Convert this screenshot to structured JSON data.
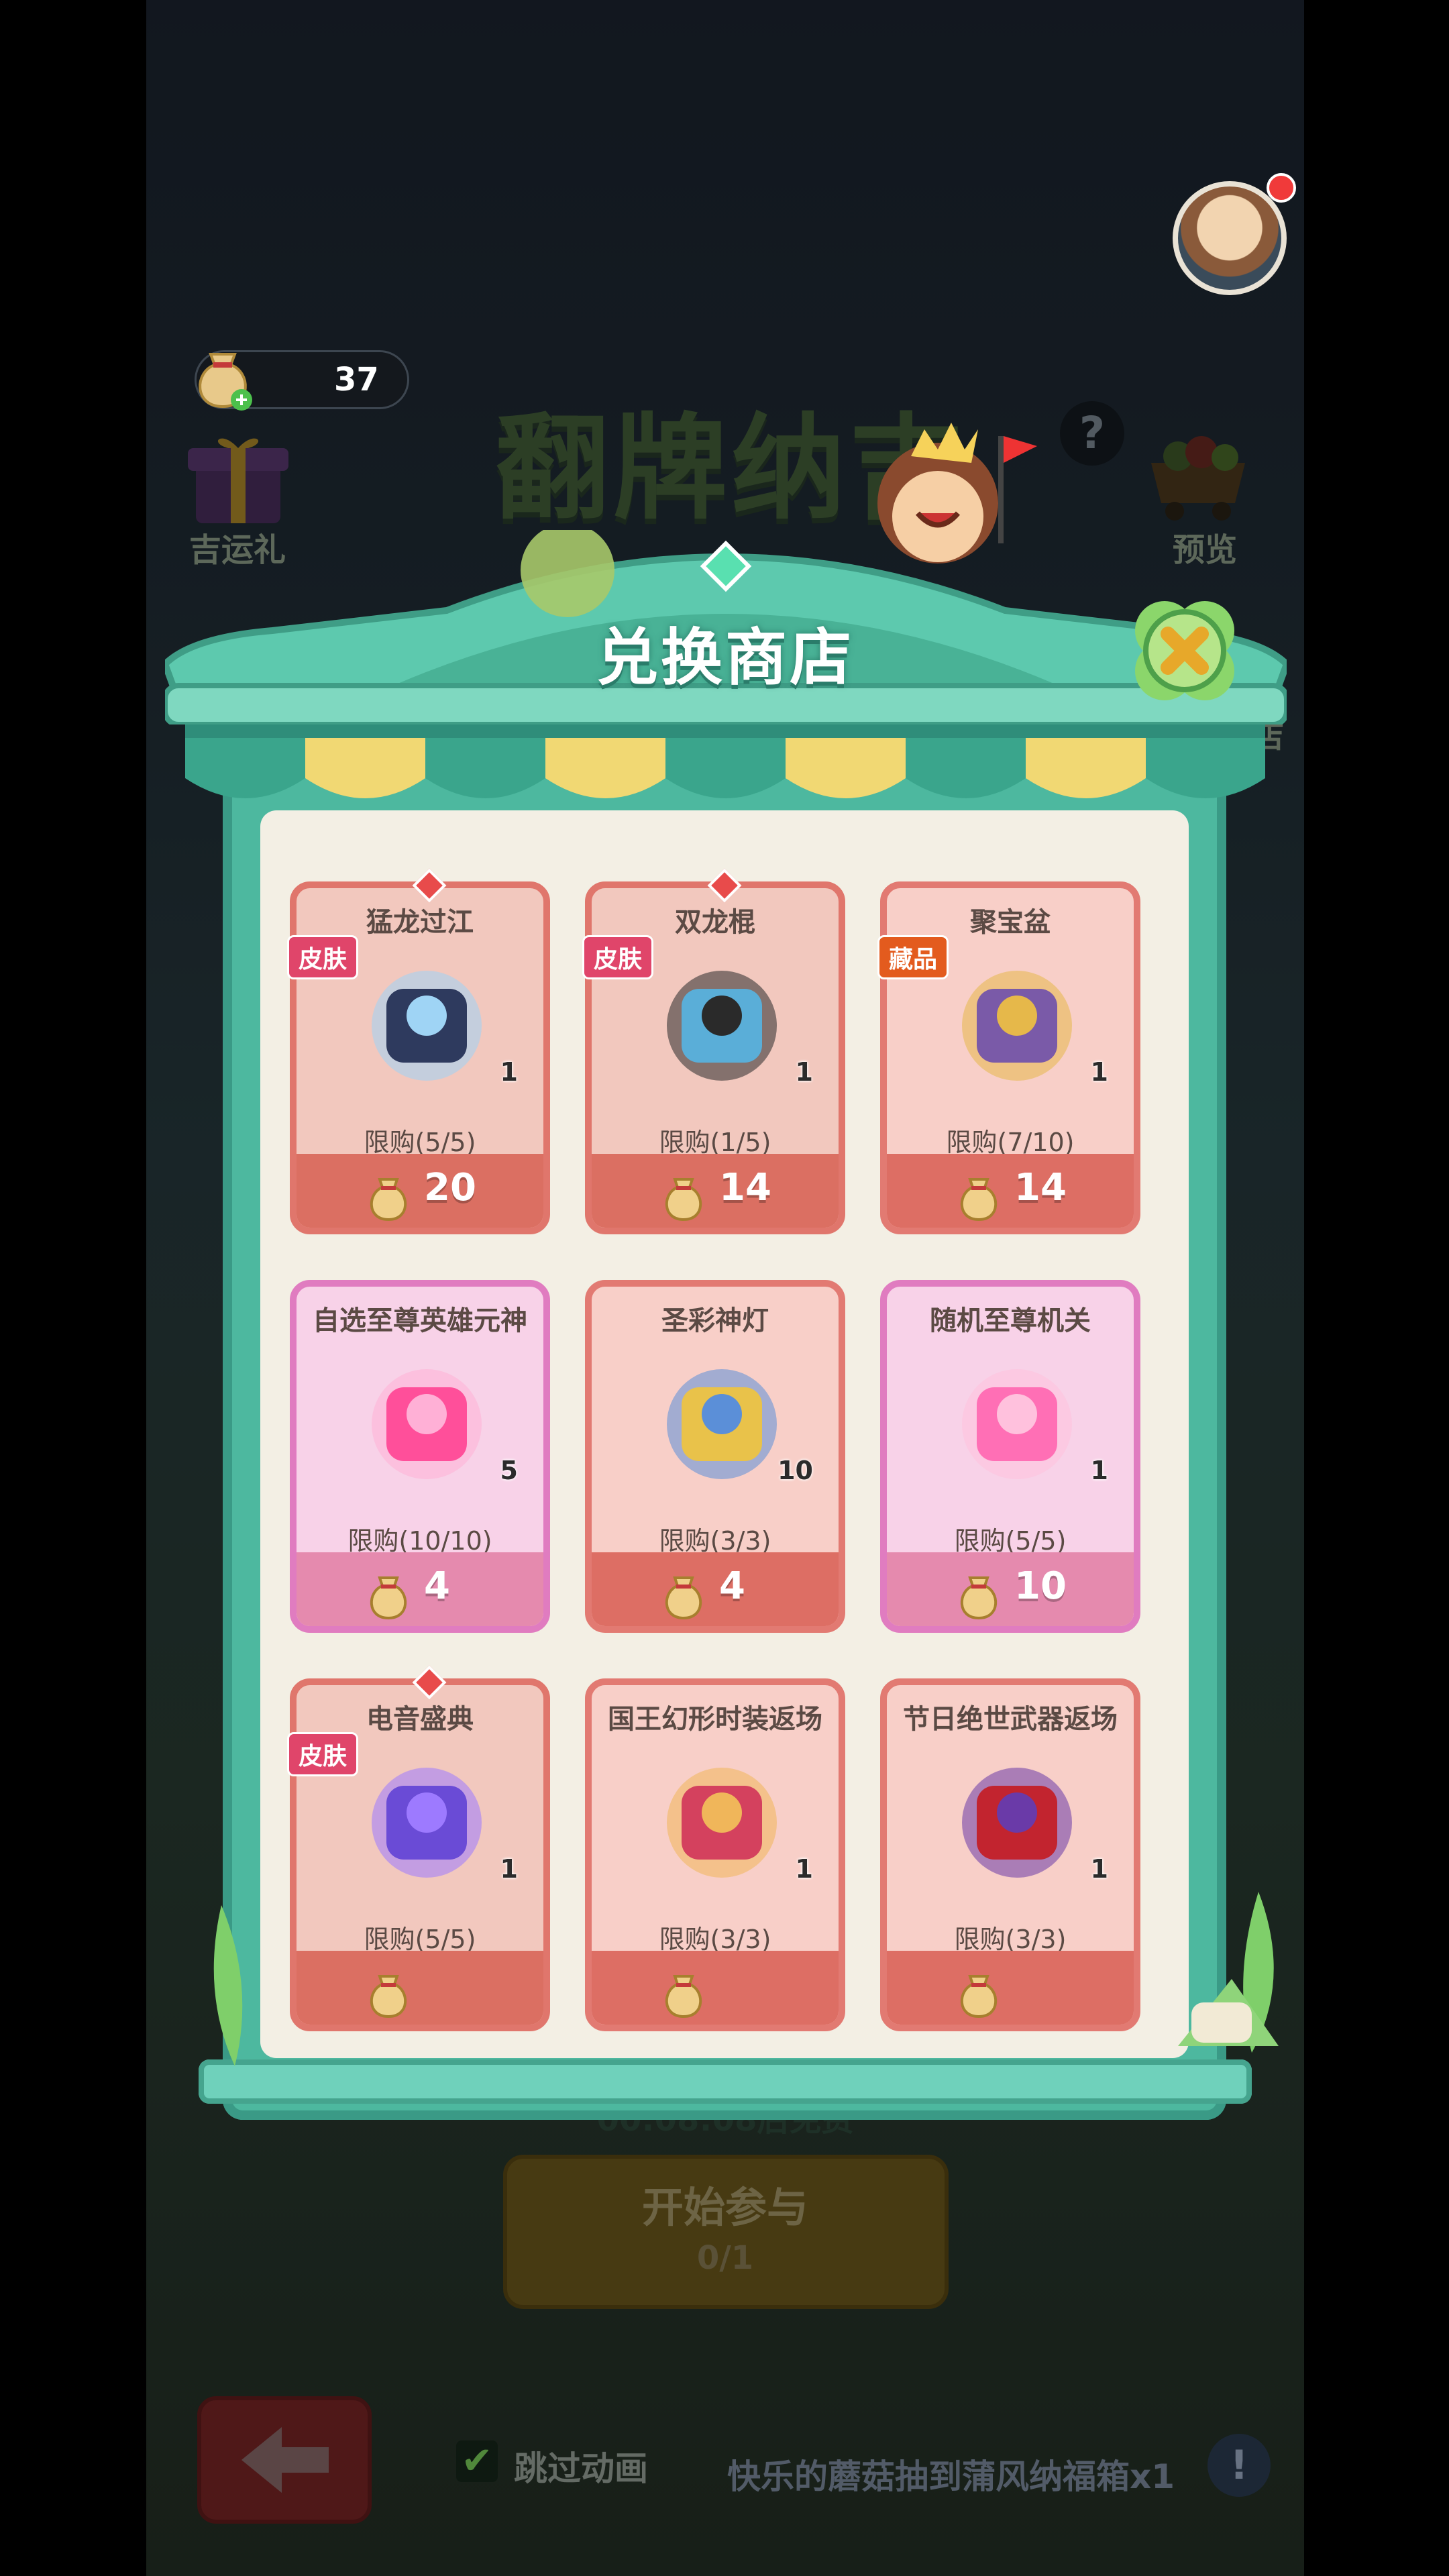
{
  "hud": {
    "currency_value": "37",
    "currency_icon": "lucky-bag-icon",
    "bg_title": "翻牌纳吉",
    "help_icon": "question-icon",
    "lucky_gift_label": "吉运礼",
    "preview_label": "预览",
    "shop_side_label": "店"
  },
  "modal": {
    "title": "兑换商店",
    "close_icon": "close-x-icon"
  },
  "items": [
    {
      "name": "猛龙过江",
      "tag": "皮肤",
      "qty": "1",
      "limit": "限购(5/5)",
      "price": "20",
      "style": "red",
      "gem": true
    },
    {
      "name": "双龙棍",
      "tag": "皮肤",
      "qty": "1",
      "limit": "限购(1/5)",
      "price": "14",
      "style": "red",
      "gem": true
    },
    {
      "name": "聚宝盆",
      "tag": "藏品",
      "qty": "1",
      "limit": "限购(7/10)",
      "price": "14",
      "style": "redpink",
      "gem": false
    },
    {
      "name": "自选至尊英雄元神",
      "tag": "",
      "qty": "5",
      "limit": "限购(10/10)",
      "price": "4",
      "style": "pink",
      "gem": false
    },
    {
      "name": "圣彩神灯",
      "tag": "",
      "qty": "10",
      "limit": "限购(3/3)",
      "price": "4",
      "style": "redpink",
      "gem": false
    },
    {
      "name": "随机至尊机关",
      "tag": "",
      "qty": "1",
      "limit": "限购(5/5)",
      "price": "10",
      "style": "pink",
      "gem": false
    },
    {
      "name": "电音盛典",
      "tag": "皮肤",
      "qty": "1",
      "limit": "限购(5/5)",
      "price": "",
      "style": "red",
      "gem": true
    },
    {
      "name": "国王幻形时装返场",
      "tag": "",
      "qty": "1",
      "limit": "限购(3/3)",
      "price": "",
      "style": "redpink",
      "gem": false
    },
    {
      "name": "节日绝世武器返场",
      "tag": "",
      "qty": "1",
      "limit": "限购(3/3)",
      "price": "",
      "style": "redpink",
      "gem": false
    }
  ],
  "behind": {
    "countdown": "00:08:08后免费",
    "start_label": "开始参与",
    "start_count": "0/1",
    "back_icon": "arrow-left-icon",
    "skip_label": "跳过动画",
    "ticker": "快乐的蘑菇抽到蒲风纳福箱x1",
    "info_icon": "exclamation-icon"
  }
}
